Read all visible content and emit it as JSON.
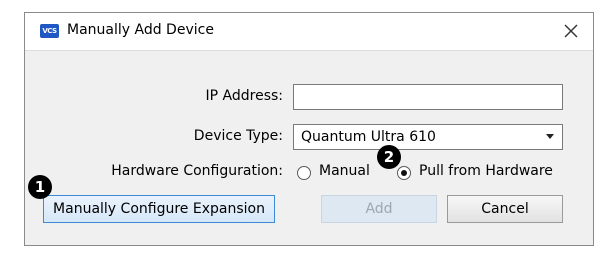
{
  "window": {
    "title": "Manually Add Device",
    "app_icon": "app-logo-icon",
    "app_icon_text": "VCS",
    "close_icon": "close-icon"
  },
  "form": {
    "ip_address": {
      "label": "IP Address:",
      "value": ""
    },
    "device_type": {
      "label": "Device Type:",
      "selected": "Quantum Ultra 610"
    },
    "hardware_configuration": {
      "label": "Hardware Configuration:",
      "options": [
        {
          "label": "Manual",
          "checked": false
        },
        {
          "label": "Pull from Hardware",
          "checked": true
        }
      ]
    }
  },
  "buttons": {
    "expansion": "Manually Configure Expansion",
    "add": "Add",
    "cancel": "Cancel"
  },
  "callouts": [
    "1",
    "2"
  ],
  "colors": {
    "dialog_bg": "#f0f0f0",
    "app_icon_bg": "#1f57c4",
    "focus_border": "#3c8ad8",
    "disabled_bg": "#dde8f3",
    "badge_bg": "#000000"
  }
}
